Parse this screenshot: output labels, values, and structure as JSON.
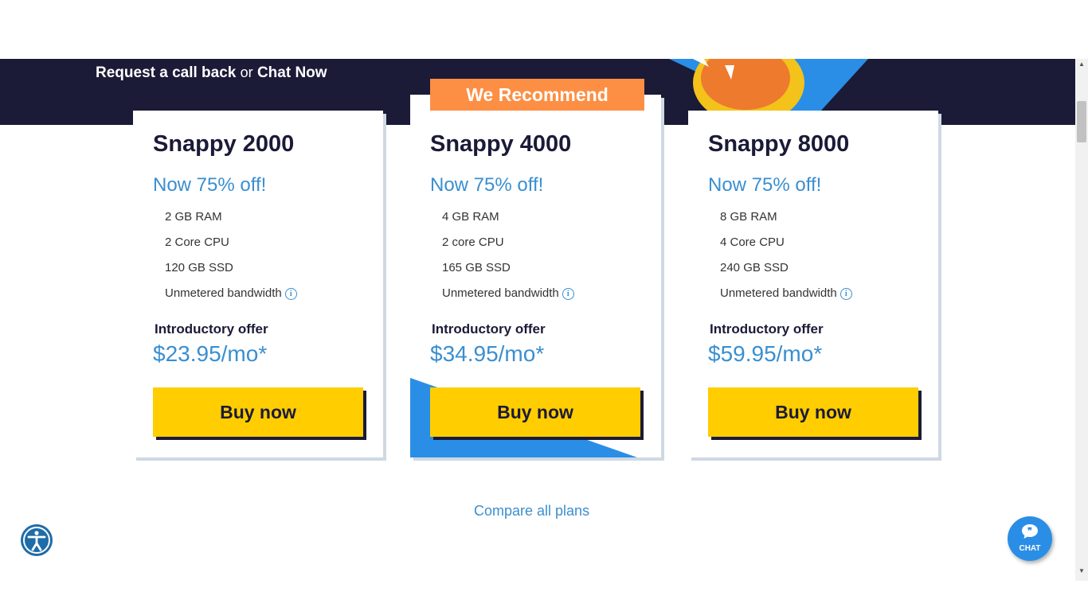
{
  "header": {
    "request_label": "Request a call back",
    "or_text": "or",
    "chat_label": "Chat Now"
  },
  "recommend_ribbon": "We Recommend",
  "plans": [
    {
      "name": "Snappy 2000",
      "discount": "Now 75% off!",
      "features": [
        "2 GB RAM",
        "2 Core CPU",
        "120 GB SSD",
        "Unmetered bandwidth"
      ],
      "intro": "Introductory offer",
      "price": "$23.95/mo*",
      "buy_label": "Buy now"
    },
    {
      "name": "Snappy 4000",
      "discount": "Now 75% off!",
      "features": [
        "4 GB RAM",
        "2 core CPU",
        "165 GB SSD",
        "Unmetered bandwidth"
      ],
      "intro": "Introductory offer",
      "price": "$34.95/mo*",
      "buy_label": "Buy now"
    },
    {
      "name": "Snappy 8000",
      "discount": "Now 75% off!",
      "features": [
        "8 GB RAM",
        "4 Core CPU",
        "240 GB SSD",
        "Unmetered bandwidth"
      ],
      "intro": "Introductory offer",
      "price": "$59.95/mo*",
      "buy_label": "Buy now"
    }
  ],
  "compare_link": "Compare all plans",
  "chat_widget": {
    "label": "CHAT"
  },
  "colors": {
    "navy": "#1b1a37",
    "accent_blue": "#3a8fd0",
    "cta_yellow": "#ffcd00",
    "ribbon_orange": "#fd8f44",
    "chat_blue": "#2a8ee6"
  },
  "icons": {
    "info": "info-icon",
    "accessibility": "accessibility-icon",
    "chat": "chat-bubble-icon"
  }
}
